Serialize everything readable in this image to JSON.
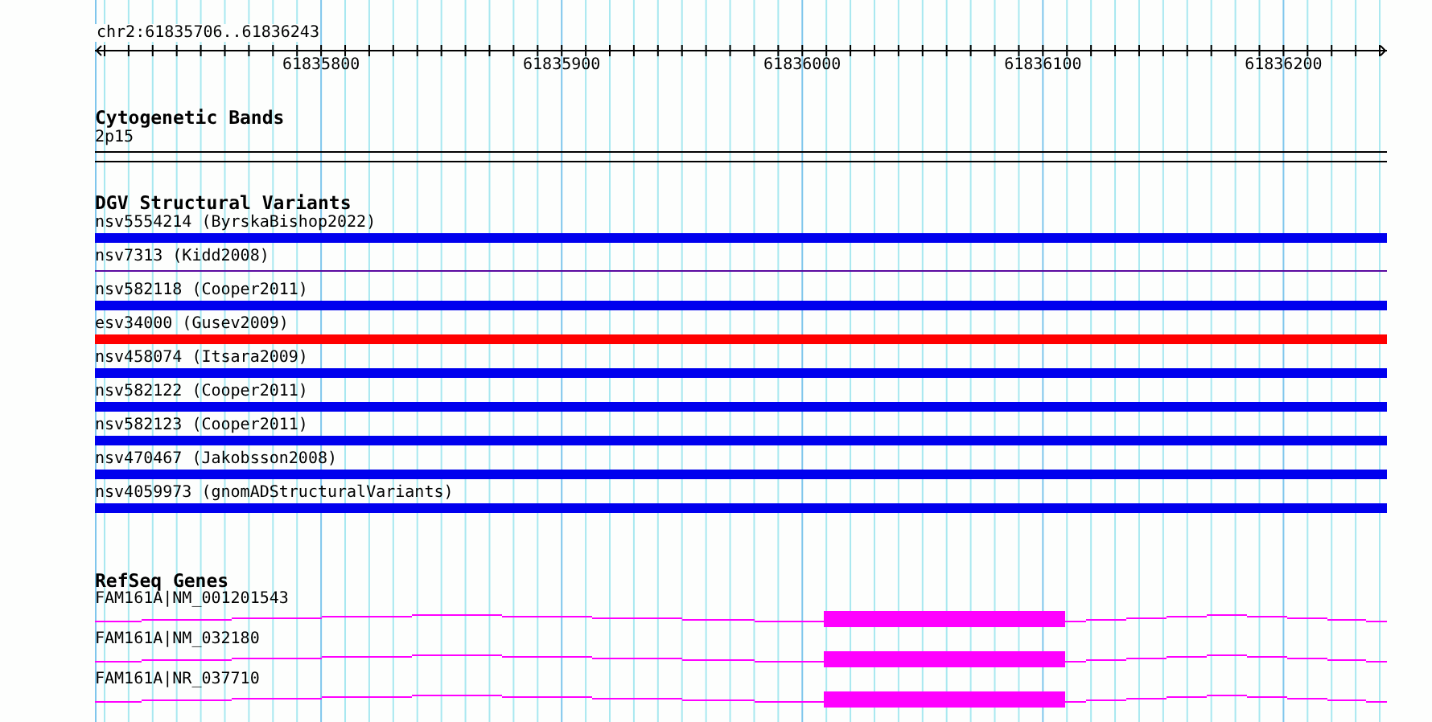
{
  "ruler": {
    "position": "chr2:61835706..61836243",
    "ticks": [
      "61835800",
      "61835900",
      "61836000",
      "61836100",
      "61836200"
    ]
  },
  "cytoband_track": {
    "title": "Cytogenetic Bands",
    "band": "2p15"
  },
  "variant_track": {
    "title": "DGV Structural Variants",
    "items": [
      {
        "label": "nsv5554214 (ByrskaBishop2022)",
        "kind": "bar",
        "color": "#0000ee"
      },
      {
        "label": "nsv7313 (Kidd2008)",
        "kind": "line",
        "color": "#5a0aa0"
      },
      {
        "label": "nsv582118 (Cooper2011)",
        "kind": "bar",
        "color": "#0000ee"
      },
      {
        "label": "esv34000 (Gusev2009)",
        "kind": "bar",
        "color": "#ff0000"
      },
      {
        "label": "nsv458074 (Itsara2009)",
        "kind": "bar",
        "color": "#0000ee"
      },
      {
        "label": "nsv582122 (Cooper2011)",
        "kind": "bar",
        "color": "#0000ee"
      },
      {
        "label": "nsv582123 (Cooper2011)",
        "kind": "bar",
        "color": "#0000ee"
      },
      {
        "label": "nsv470467 (Jakobsson2008)",
        "kind": "bar",
        "color": "#0000ee"
      },
      {
        "label": "nsv4059973 (gnomADStructuralVariants)",
        "kind": "bar",
        "color": "#0000ee"
      }
    ]
  },
  "gene_track": {
    "title": "RefSeq Genes",
    "items": [
      {
        "label": "FAM161A|NM_001201543"
      },
      {
        "label": "FAM161A|NM_032180"
      },
      {
        "label": "FAM161A|NR_037710"
      }
    ]
  }
}
